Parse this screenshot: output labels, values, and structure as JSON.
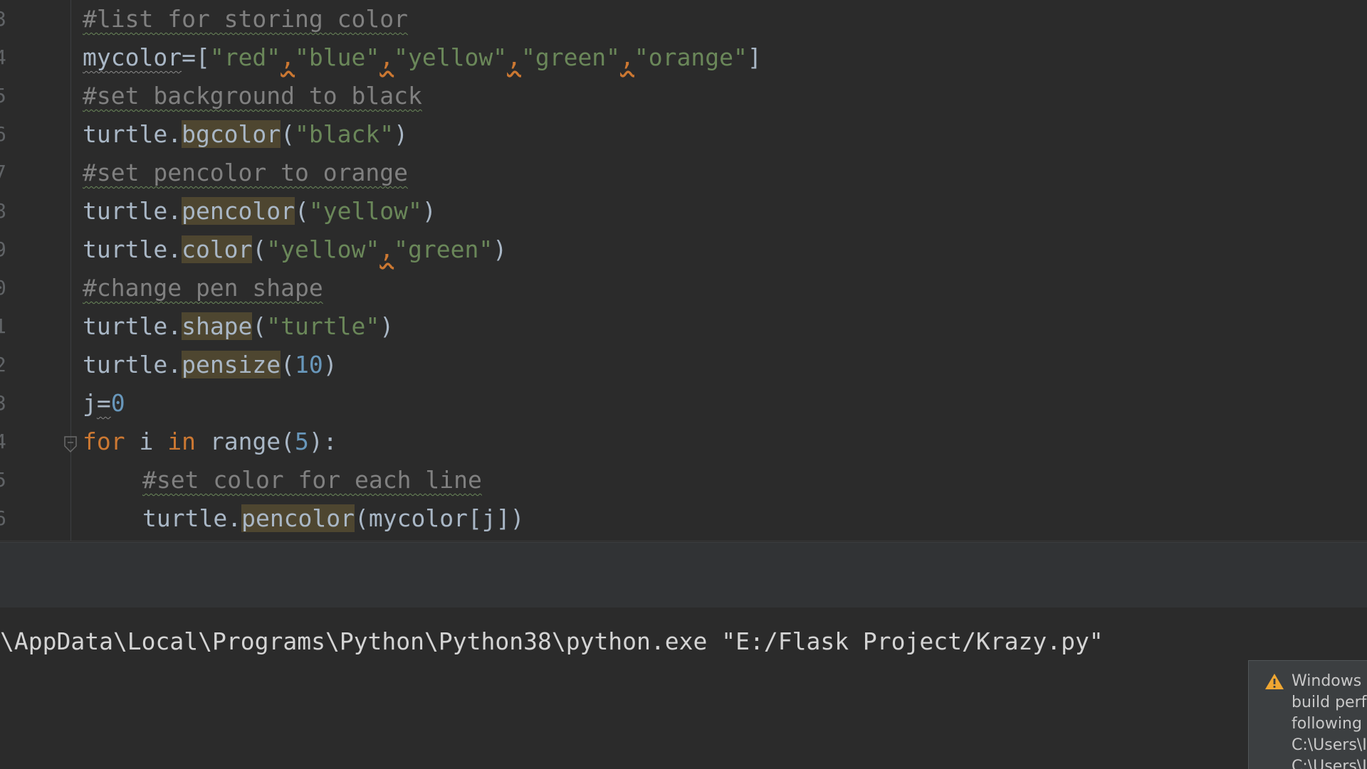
{
  "editor": {
    "line_numbers": [
      "3",
      "4",
      "5",
      "6",
      "7",
      "8",
      "9",
      "0",
      "1",
      "2",
      "3",
      "4",
      "5",
      "6"
    ],
    "lines": {
      "l1": {
        "comment": "#list for storing color"
      },
      "l2": {
        "a": "mycolor",
        "b": "=[",
        "s1": "\"red\"",
        "c1": ",",
        "s2": "\"blue\"",
        "c2": ",",
        "s3": "\"yellow\"",
        "c3": ",",
        "s4": "\"green\"",
        "c4": ",",
        "s5": "\"orange\"",
        "end": "]"
      },
      "l3": {
        "comment": "#set background to black"
      },
      "l4": {
        "obj": "turtle.",
        "fn": "bgcolor",
        "open": "(",
        "s": "\"black\"",
        "close": ")"
      },
      "l5": {
        "comment": "#set pencolor to orange"
      },
      "l6": {
        "obj": "turtle.",
        "fn": "pencolor",
        "open": "(",
        "s": "\"yellow\"",
        "close": ")"
      },
      "l7": {
        "obj": "turtle.",
        "fn": "color",
        "open": "(",
        "s1": "\"yellow\"",
        "c": ",",
        "s2": "\"green\"",
        "close": ")"
      },
      "l8": {
        "comment": "#change pen shape"
      },
      "l9": {
        "obj": "turtle.",
        "fn": "shape",
        "open": "(",
        "s": "\"turtle\"",
        "close": ")"
      },
      "l10": {
        "obj": "turtle.",
        "fn": "pensize",
        "open": "(",
        "n": "10",
        "close": ")"
      },
      "l11": {
        "v": "j",
        "eq": "=",
        "n": "0"
      },
      "l12": {
        "kw1": "for",
        "i": " i ",
        "kw2": "in",
        "rest1": " range(",
        "n": "5",
        "rest2": "):"
      },
      "l13": {
        "comment": "#set color for each line"
      },
      "l14": {
        "obj": "turtle.",
        "fn": "pencolor",
        "arg": "(mycolor[j])"
      }
    }
  },
  "console": {
    "command": "\\AppData\\Local\\Programs\\Python\\Python38\\python.exe \"E:/Flask Project/Krazy.py\""
  },
  "notification": {
    "icon": "warning-icon",
    "lines": [
      "Windows D",
      "build perfo",
      "following c",
      "C:\\Users\\IN",
      "C:\\Users\\IN"
    ]
  },
  "colors": {
    "background": "#2b2b2b",
    "comment": "#808080",
    "string": "#6a8759",
    "keyword": "#cc7832",
    "number": "#6897bb",
    "highlight": "#4e4630"
  }
}
